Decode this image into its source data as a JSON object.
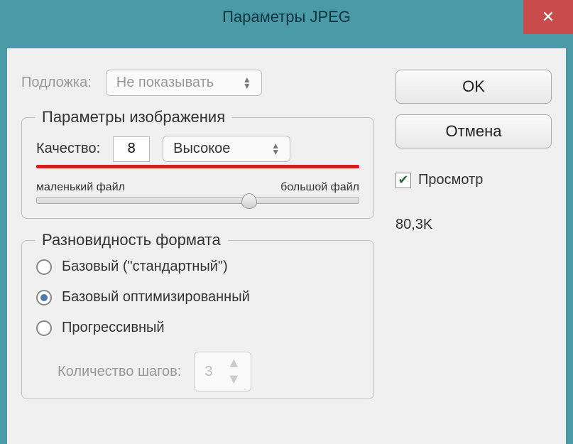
{
  "window": {
    "title": "Параметры JPEG"
  },
  "backing": {
    "label": "Подложка:",
    "value": "Не показывать"
  },
  "image_options": {
    "legend": "Параметры изображения",
    "quality_label": "Качество:",
    "quality_value": "8",
    "quality_preset": "Высокое",
    "slider_min_label": "маленький файл",
    "slider_max_label": "большой файл"
  },
  "format_options": {
    "legend": "Разновидность формата",
    "options": [
      {
        "label": "Базовый (\"стандартный\")",
        "checked": false
      },
      {
        "label": "Базовый оптимизированный",
        "checked": true
      },
      {
        "label": "Прогрессивный",
        "checked": false
      }
    ],
    "steps_label": "Количество шагов:",
    "steps_value": "3"
  },
  "buttons": {
    "ok": "OK",
    "cancel": "Отмена"
  },
  "preview": {
    "label": "Просмотр",
    "checked": true
  },
  "filesize": "80,3K"
}
